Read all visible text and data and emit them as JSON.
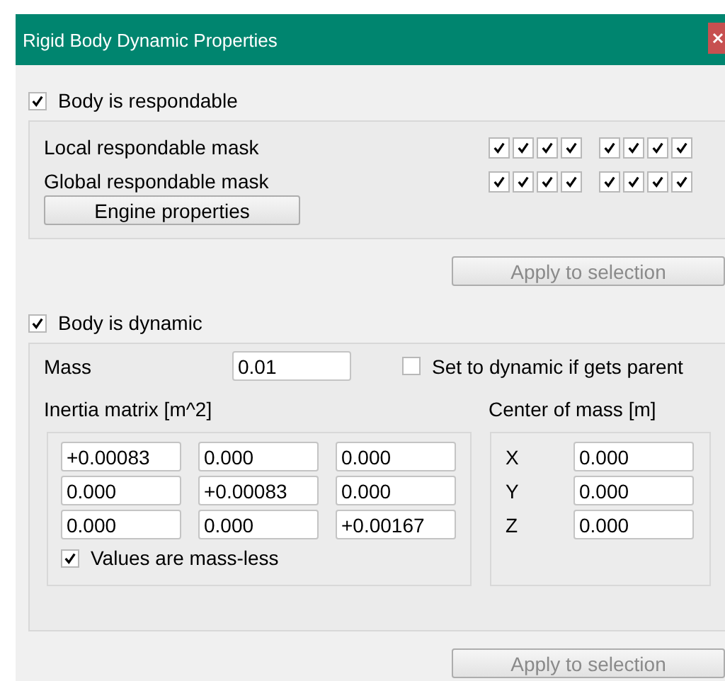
{
  "window": {
    "title": "Rigid Body Dynamic Properties"
  },
  "respondable": {
    "label": "Body is respondable",
    "checked": true,
    "masks": [
      {
        "label": "Local respondable mask",
        "bits": [
          true,
          true,
          true,
          true,
          true,
          true,
          true,
          true
        ]
      },
      {
        "label": "Global respondable mask",
        "bits": [
          true,
          true,
          true,
          true,
          true,
          true,
          true,
          true
        ]
      }
    ],
    "engine_button": "Engine properties",
    "apply_button": {
      "label": "Apply to selection",
      "disabled": true
    }
  },
  "dynamic": {
    "label": "Body is dynamic",
    "checked": true,
    "mass": {
      "label": "Mass",
      "value": "0.01"
    },
    "parent_option": {
      "label": "Set to dynamic if gets parent",
      "checked": false
    },
    "inertia": {
      "label": "Inertia matrix [m^2]",
      "rows": [
        [
          "+0.00083",
          "0.000",
          "0.000"
        ],
        [
          "0.000",
          "+0.00083",
          "0.000"
        ],
        [
          "0.000",
          "0.000",
          "+0.00167"
        ]
      ],
      "massless": {
        "label": "Values are mass-less",
        "checked": true
      }
    },
    "center_of_mass": {
      "label": "Center of mass [m]",
      "axes": [
        {
          "axis": "X",
          "value": "0.000"
        },
        {
          "axis": "Y",
          "value": "0.000"
        },
        {
          "axis": "Z",
          "value": "0.000"
        }
      ]
    },
    "apply_button": {
      "label": "Apply to selection",
      "disabled": true
    }
  }
}
